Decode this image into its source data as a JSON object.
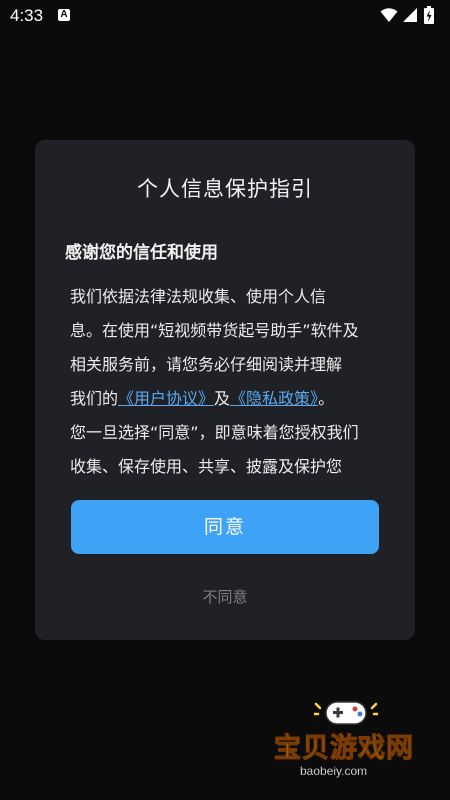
{
  "status_bar": {
    "time": "4:33",
    "notification_icon": "a-badge-icon",
    "icons": [
      "wifi-icon",
      "signal-icon",
      "battery-charging-icon"
    ]
  },
  "dialog": {
    "title": "个人信息保护指引",
    "subtitle": "感谢您的信任和使用",
    "body": {
      "line1": "我们依据法律法规收集、使用个人信",
      "line2": "息。在使用“短视频带货起号助手”软件及",
      "line3": "相关服务前，请您务必仔细阅读并理解",
      "line4_prefix": "我们的",
      "user_agreement_link": "《用户协议》",
      "line4_and": "及",
      "privacy_policy_link": "《隐私政策》",
      "line4_suffix": "。",
      "line5": "您一旦选择“同意”，即意味着您授权我们",
      "line6": "收集、保存使用、共享、披露及保护您"
    },
    "agree_label": "同意",
    "disagree_label": "不同意"
  },
  "watermark": {
    "logo_text": "宝贝游戏网",
    "url": "baobeiy.com"
  },
  "colors": {
    "background": "#0b0b0c",
    "dialog": "#1f2126",
    "accent": "#3ea2f6",
    "link": "#5aa9f0",
    "muted": "#7d7f84"
  }
}
